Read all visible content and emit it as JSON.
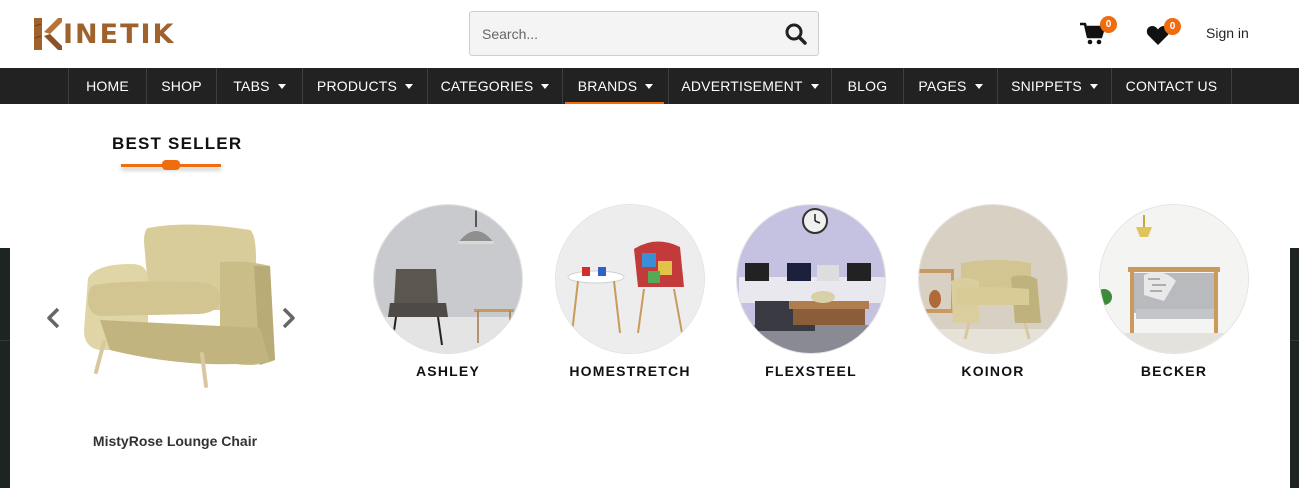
{
  "header": {
    "logo_text": "INETIK",
    "search_placeholder": "Search...",
    "cart_count": "0",
    "wishlist_count": "0",
    "signin_label": "Sign in"
  },
  "nav": {
    "items": [
      {
        "label": "HOME"
      },
      {
        "label": "SHOP"
      },
      {
        "label": "TABS"
      },
      {
        "label": "PRODUCTS"
      },
      {
        "label": "CATEGORIES"
      },
      {
        "label": "BRANDS"
      },
      {
        "label": "ADVERTISEMENT"
      },
      {
        "label": "BLOG"
      },
      {
        "label": "PAGES"
      },
      {
        "label": "SNIPPETS"
      },
      {
        "label": "CONTACT US"
      }
    ]
  },
  "dropdown": {
    "section_title": "BEST SELLER",
    "product_name": "MistyRose Lounge Chair",
    "brands": [
      {
        "label": "ASHLEY"
      },
      {
        "label": "HOMESTRETCH"
      },
      {
        "label": "FLEXSTEEL"
      },
      {
        "label": "KOINOR"
      },
      {
        "label": "BECKER"
      }
    ]
  },
  "colors": {
    "accent": "#ef6c0f",
    "nav_bg": "#222222",
    "logo": "#a0622d"
  },
  "icons": [
    "search-icon",
    "cart-icon",
    "heart-icon",
    "chevron-left-icon",
    "chevron-right-icon"
  ]
}
